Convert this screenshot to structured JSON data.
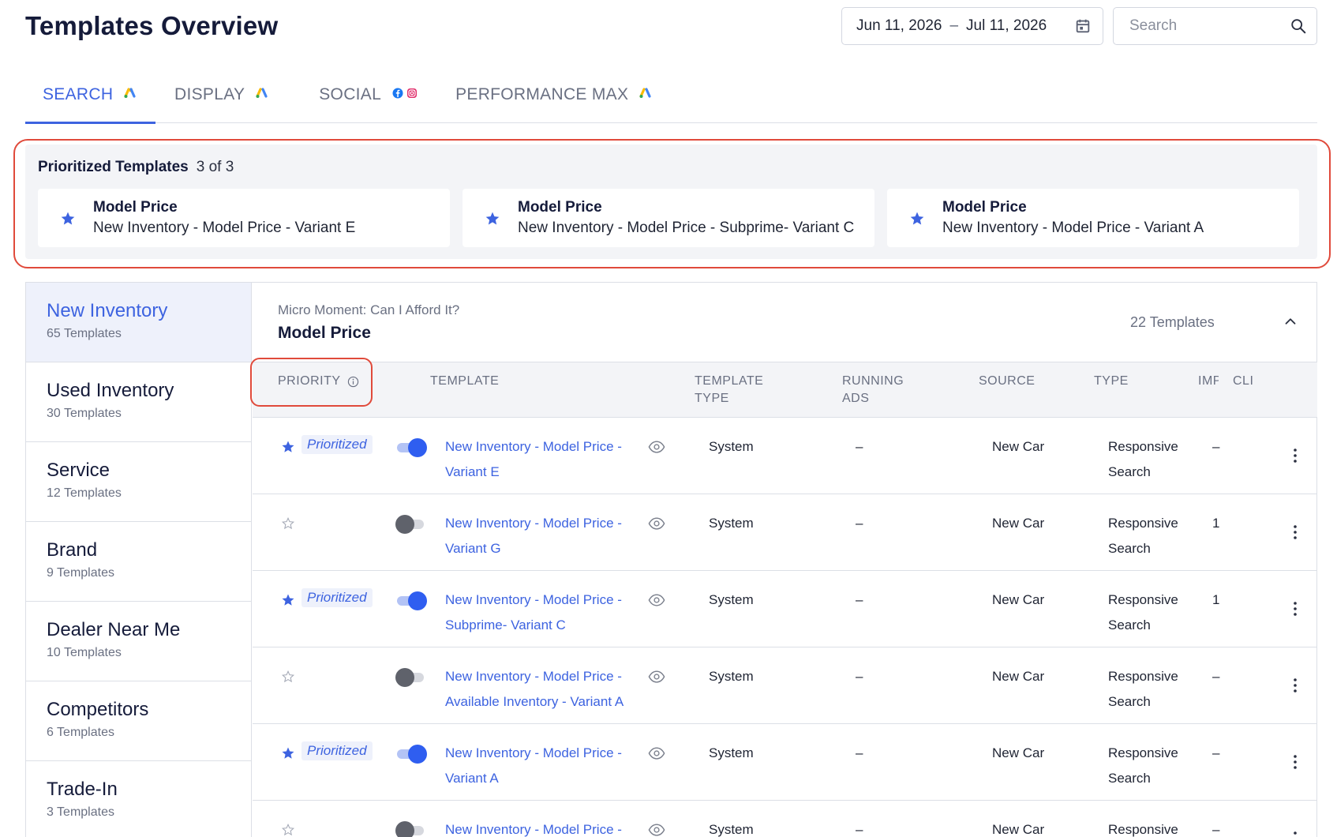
{
  "page": {
    "title": "Templates Overview"
  },
  "date_range": {
    "start": "Jun 11, 2026",
    "separator": "–",
    "end": "Jul 11, 2026"
  },
  "search": {
    "placeholder": "Search"
  },
  "tabs": [
    {
      "label": "SEARCH",
      "active": true,
      "badge": [
        "google-ads-icon"
      ]
    },
    {
      "label": "DISPLAY",
      "active": false,
      "badge": [
        "google-ads-icon"
      ]
    },
    {
      "label": "SOCIAL",
      "active": false,
      "badge": [
        "facebook-icon",
        "instagram-icon"
      ]
    },
    {
      "label": "PERFORMANCE MAX",
      "active": false,
      "badge": [
        "google-ads-icon"
      ]
    }
  ],
  "prioritized": {
    "title": "Prioritized Templates",
    "count": "3 of 3",
    "cards": [
      {
        "group": "Model Price",
        "template": "New Inventory - Model Price - Variant E"
      },
      {
        "group": "Model Price",
        "template": "New Inventory - Model Price - Subprime- Variant C"
      },
      {
        "group": "Model Price",
        "template": "New Inventory - Model Price - Variant A"
      }
    ]
  },
  "sidebar": {
    "items": [
      {
        "label": "New Inventory",
        "count": "65 Templates",
        "active": true
      },
      {
        "label": "Used Inventory",
        "count": "30 Templates"
      },
      {
        "label": "Service",
        "count": "12 Templates"
      },
      {
        "label": "Brand",
        "count": "9 Templates"
      },
      {
        "label": "Dealer Near Me",
        "count": "10 Templates"
      },
      {
        "label": "Competitors",
        "count": "6 Templates"
      },
      {
        "label": "Trade-In",
        "count": "3 Templates"
      }
    ]
  },
  "group": {
    "micro_moment": "Micro Moment: Can I Afford It?",
    "name": "Model Price",
    "count": "22 Templates"
  },
  "table": {
    "headers": {
      "priority": "PRIORITY",
      "template": "TEMPLATE",
      "template_type": "TEMPLATE TYPE",
      "running_ads": "RUNNING ADS",
      "source": "SOURCE",
      "type": "TYPE",
      "imp": "IMPRESSIONS",
      "cli": "CLICKS"
    },
    "prioritized_label": "Prioritized",
    "rows": [
      {
        "prioritized": true,
        "enabled": true,
        "name": "New Inventory - Model Price - Variant E",
        "template_type": "System",
        "running_ads": "–",
        "source": "New Car",
        "type": "Responsive Search",
        "imp": "–"
      },
      {
        "prioritized": false,
        "enabled": false,
        "name": "New Inventory - Model Price - Variant G",
        "template_type": "System",
        "running_ads": "–",
        "source": "New Car",
        "type": "Responsive Search",
        "imp": "1"
      },
      {
        "prioritized": true,
        "enabled": true,
        "name": "New Inventory - Model Price - Subprime- Variant C",
        "template_type": "System",
        "running_ads": "–",
        "source": "New Car",
        "type": "Responsive Search",
        "imp": "1"
      },
      {
        "prioritized": false,
        "enabled": false,
        "name": "New Inventory - Model Price - Available Inventory - Variant A",
        "template_type": "System",
        "running_ads": "–",
        "source": "New Car",
        "type": "Responsive Search",
        "imp": "–"
      },
      {
        "prioritized": true,
        "enabled": true,
        "name": "New Inventory - Model Price - Variant A",
        "template_type": "System",
        "running_ads": "–",
        "source": "New Car",
        "type": "Responsive Search",
        "imp": "–"
      },
      {
        "prioritized": false,
        "enabled": false,
        "name": "New Inventory - Model Price -",
        "template_type": "System",
        "running_ads": "–",
        "source": "New Car",
        "type": "Responsive",
        "imp": "–"
      }
    ]
  },
  "colors": {
    "accent": "#3d63e0",
    "highlight_outline": "#e04a3b",
    "toggle_on": "#2f5ef0"
  }
}
